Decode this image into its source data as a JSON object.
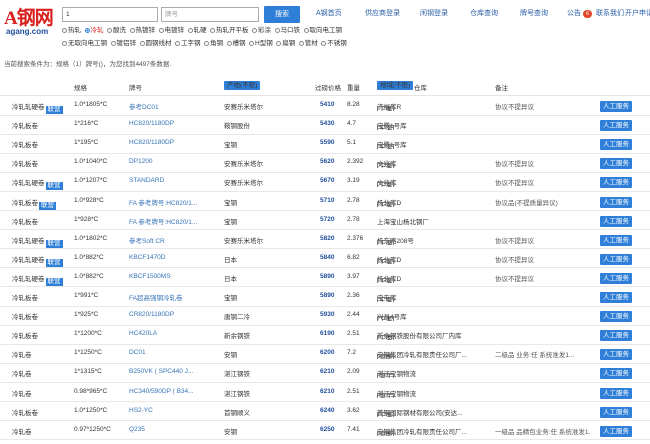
{
  "logo": {
    "text": "A钢网",
    "sub": "agang.com"
  },
  "search": {
    "value": "1",
    "grade_placeholder": "牌号",
    "button": "搜索"
  },
  "nav": {
    "items": [
      "A钢首页",
      "供应商登录",
      "闲钢登录",
      "仓库查询",
      "牌号查询",
      "公告",
      "联系我们",
      "开户申请"
    ],
    "notice_count": "6"
  },
  "categories": {
    "row1": [
      "热轧",
      "冷轧",
      "酸洗",
      "热镀锌",
      "电镀锌",
      "轧硬",
      "热轧开平板",
      "彩涂",
      "马口铁",
      "取向电工钢"
    ],
    "row2": [
      "无取向电工钢",
      "镀铝锌",
      "圆钢线材",
      "工字钢",
      "角钢",
      "槽钢",
      "H型钢",
      "扁钢",
      "管材",
      "不锈钢"
    ],
    "selected": "冷轧"
  },
  "summary": "当前搜索条件为：规格（1）牌号()，为您找到4497条数据.",
  "columns": {
    "spec": "规格",
    "grade": "牌号",
    "maker": "产地(不限)",
    "price": "过磅价格",
    "weight": "重量",
    "region": "地域(不限)",
    "warehouse": "仓库",
    "note": "备注"
  },
  "service_label": "人工服务",
  "rows": [
    {
      "name": "冷轧轧硬卷",
      "tag": "联营",
      "spec": "1.0*1805*C",
      "grade": "参考DC01",
      "maker": "安赛乐米塔尔",
      "price": "5410",
      "weight": "8.28",
      "city": "上海",
      "warehouse": "济福库R",
      "note": "协议不提异议"
    },
    {
      "name": "冷轧板卷",
      "tag": "",
      "spec": "1*216*C",
      "grade": "HC820/1180DP",
      "maker": "鞍钢股份",
      "price": "5430",
      "weight": "4.7",
      "city": "上海",
      "warehouse": "宝腾1号库",
      "note": ""
    },
    {
      "name": "冷轧板卷",
      "tag": "",
      "spec": "1*195*C",
      "grade": "HC820/1180DP",
      "maker": "宝钢",
      "price": "5590",
      "weight": "5.1",
      "city": "上海",
      "warehouse": "宝腾1号库",
      "note": ""
    },
    {
      "name": "冷轧板卷",
      "tag": "",
      "spec": "1.0*1040*C",
      "grade": "DP1200",
      "maker": "安赛乐米塔尔",
      "price": "5620",
      "weight": "2.392",
      "city": "上海",
      "warehouse": "文兆库",
      "note": "协议不提异议"
    },
    {
      "name": "冷轧轧硬卷",
      "tag": "联营",
      "spec": "1.0*1207*C",
      "grade": "STANDARD",
      "maker": "安赛乐米塔尔",
      "price": "5670",
      "weight": "3.19",
      "city": "上海",
      "warehouse": "文兆库",
      "note": "协议不提异议"
    },
    {
      "name": "冷轧板卷",
      "tag": "联营",
      "spec": "1.0*928*C",
      "grade": "FA 参考牌号:HC820/1...",
      "maker": "宝钢",
      "price": "5710",
      "weight": "2.78",
      "city": "上海",
      "warehouse": "杨北库D",
      "note": "协议品(不提质量异议)"
    },
    {
      "name": "冷轧板卷",
      "tag": "",
      "spec": "1*928*C",
      "grade": "FA 参考牌号:HC820/1...",
      "maker": "宝钢",
      "price": "5720",
      "weight": "2.78",
      "city": "",
      "warehouse": "上海宝山杨北钢厂",
      "note": ""
    },
    {
      "name": "冷轧轧硬卷",
      "tag": "联营",
      "spec": "1.0*1802*C",
      "grade": "参考Soft CR",
      "maker": "安赛乐米塔尔",
      "price": "5820",
      "warehouse": "杨东路208号",
      "weight": "2.376",
      "city": "上海",
      "note": "协议不提异议"
    },
    {
      "name": "冷轧轧硬卷",
      "tag": "联营",
      "spec": "1.0*882*C",
      "grade": "KBCF1470D",
      "maker": "日本",
      "price": "5840",
      "weight": "6.82",
      "city": "上海",
      "warehouse": "杨北库D",
      "note": "协议不提异议"
    },
    {
      "name": "冷轧轧硬卷",
      "tag": "联营",
      "spec": "1.0*882*C",
      "grade": "KBCF1500MS",
      "maker": "日本",
      "price": "5890",
      "weight": "3.97",
      "city": "上海",
      "warehouse": "杨北库D",
      "note": "协议不提异议"
    },
    {
      "name": "冷轧板卷",
      "tag": "",
      "spec": "1*991*C",
      "grade": "FA超高强钢冷轧卷",
      "maker": "宝钢",
      "price": "5890",
      "weight": "2.36",
      "city": "上海",
      "warehouse": "宝屯库",
      "note": ""
    },
    {
      "name": "冷轧板卷",
      "tag": "",
      "spec": "1*925*C",
      "grade": "CR820/1180DP",
      "maker": "唐钢二冷",
      "price": "5930",
      "weight": "2.44",
      "city": "上海",
      "warehouse": "兴昌4号库",
      "note": ""
    },
    {
      "name": "冷轧板卷",
      "tag": "",
      "spec": "1*1200*C",
      "grade": "HC420LA",
      "maker": "新余钢铁",
      "price": "6190",
      "weight": "2.51",
      "city": "上海",
      "warehouse": "新余钢铁股份有限公司厂内库",
      "note": ""
    },
    {
      "name": "冷轧卷",
      "tag": "",
      "spec": "1*1250*C",
      "grade": "DC01",
      "maker": "安钢",
      "price": "6200",
      "weight": "7.2",
      "city": "河南",
      "warehouse": "安钢集团冷轧有限责任公司厂...",
      "note": "二级品 业务:任 系统准发1..."
    },
    {
      "name": "冷轧卷",
      "tag": "",
      "spec": "1*1315*C",
      "grade": "B250VK ( SPC440 J...",
      "maker": "湛江钢铁",
      "price": "6210",
      "weight": "2.09",
      "city": "湛江",
      "warehouse": "湛江宝钢物流",
      "note": ""
    },
    {
      "name": "冷轧卷",
      "tag": "",
      "spec": "0.98*965*C",
      "grade": "HC340/590DP ( B34...",
      "maker": "湛江钢铁",
      "price": "6210",
      "weight": "2.51",
      "city": "湛江",
      "warehouse": "湛江宝钢物流",
      "note": ""
    },
    {
      "name": "冷轧板卷",
      "tag": "",
      "spec": "1.0*1250*C",
      "grade": "HS2-YC",
      "maker": "首钢顺义",
      "price": "6240",
      "weight": "3.62",
      "city": "上海",
      "warehouse": "首钢国际钢材有限公司(安达...",
      "note": ""
    },
    {
      "name": "冷轧卷",
      "tag": "",
      "spec": "0.97*1250*C",
      "grade": "Q235",
      "maker": "安钢",
      "price": "6250",
      "weight": "7.41",
      "city": "河南",
      "warehouse": "安钢集团冷轧有限责任公司厂...",
      "note": "一级品 品精包业务:任 系统准发1..."
    }
  ]
}
